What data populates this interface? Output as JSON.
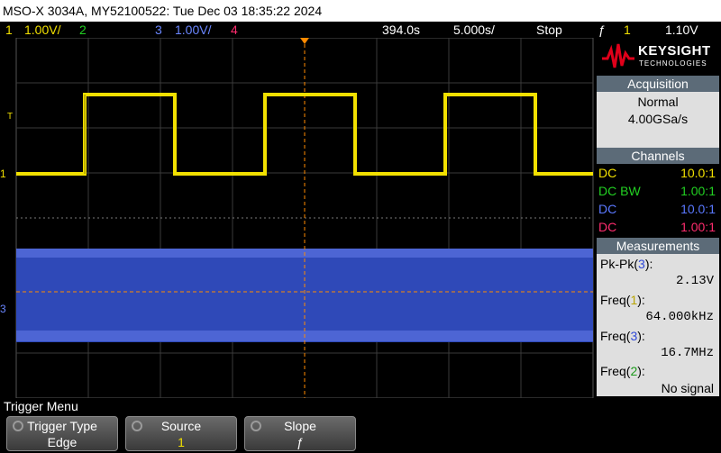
{
  "title_bar": "MSO-X 3034A, MY52100522: Tue Dec 03 18:35:22 2024",
  "status": {
    "ch1_num": "1",
    "ch1_scale": "1.00V/",
    "ch2_num": "2",
    "ch3_num": "3",
    "ch3_scale": "1.00V/",
    "ch4_num": "4",
    "delay": "394.0s",
    "timebase": "5.000s/",
    "run_state": "Stop",
    "trigger_slope_icon": "rising-edge-icon",
    "trigger_source": "1",
    "trigger_level": "1.10V"
  },
  "markers": {
    "trigger_T": "T",
    "ch1": "1",
    "ch3": "3"
  },
  "brand": {
    "name": "KEYSIGHT",
    "sub": "TECHNOLOGIES"
  },
  "acquisition": {
    "heading": "Acquisition",
    "mode": "Normal",
    "rate": "4.00GSa/s"
  },
  "channels": {
    "heading": "Channels",
    "rows": [
      {
        "coupling": "DC",
        "probe": "10.0:1",
        "color": "#f2e000"
      },
      {
        "coupling": "DC BW",
        "probe": "1.00:1",
        "color": "#22d022"
      },
      {
        "coupling": "DC",
        "probe": "10.0:1",
        "color": "#5a78ff"
      },
      {
        "coupling": "DC",
        "probe": "1.00:1",
        "color": "#ff2c6e"
      }
    ]
  },
  "measurements": {
    "heading": "Measurements",
    "items": [
      {
        "name": "Pk-Pk",
        "ch": "3",
        "value": "2.13V"
      },
      {
        "name": "Freq",
        "ch": "1",
        "value": "64.000kHz"
      },
      {
        "name": "Freq",
        "ch": "3",
        "value": "16.7MHz"
      },
      {
        "name": "Freq",
        "ch": "2",
        "value": "No signal"
      }
    ]
  },
  "menu": {
    "title": "Trigger Menu",
    "softkeys": [
      {
        "label": "Trigger Type",
        "value": "Edge"
      },
      {
        "label": "Source",
        "value": "1"
      },
      {
        "label": "Slope",
        "value": "ƒ"
      }
    ]
  },
  "colors": {
    "ch1": "#f2e000",
    "ch2": "#22d022",
    "ch3": "#4a64d8",
    "ch4": "#ff2c6e",
    "trigger": "#ff8a00"
  }
}
